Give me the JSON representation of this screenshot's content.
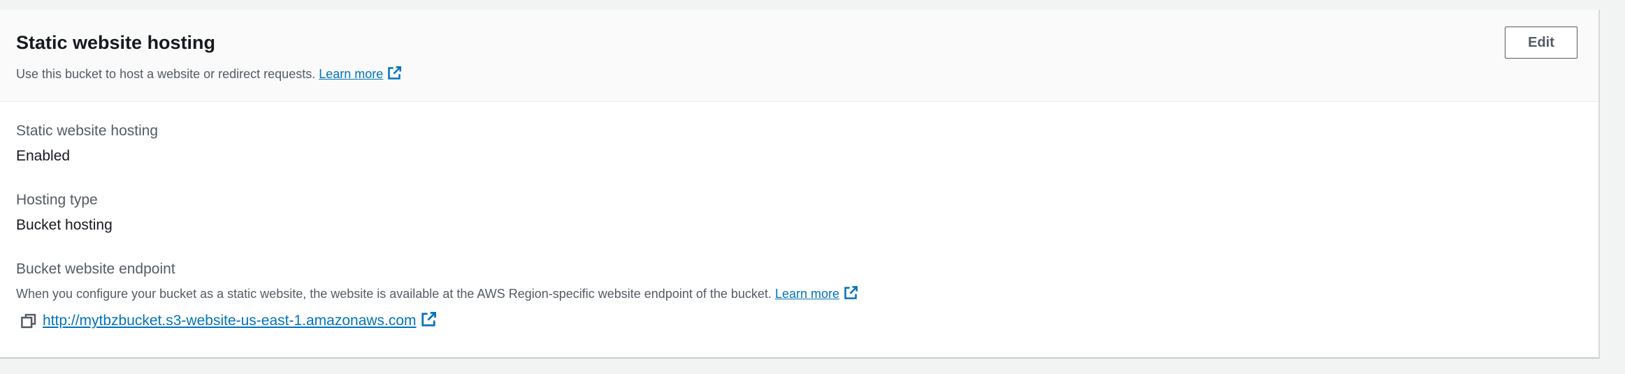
{
  "header": {
    "title": "Static website hosting",
    "description": "Use this bucket to host a website or redirect requests.",
    "learn_more": "Learn more",
    "edit_label": "Edit"
  },
  "fields": {
    "hosting_label": "Static website hosting",
    "hosting_value": "Enabled",
    "type_label": "Hosting type",
    "type_value": "Bucket hosting",
    "endpoint_label": "Bucket website endpoint",
    "endpoint_description": "When you configure your bucket as a static website, the website is available at the AWS Region-specific website endpoint of the bucket.",
    "endpoint_learn_more": "Learn more",
    "endpoint_url": "http://mytbzbucket.s3-website-us-east-1.amazonaws.com"
  },
  "icons": {
    "external_link": "external-link-icon",
    "copy": "copy-icon"
  },
  "colors": {
    "link": "#0073bb",
    "text": "#16191f",
    "secondary_text": "#545b64",
    "header_bg": "#fafafa"
  }
}
